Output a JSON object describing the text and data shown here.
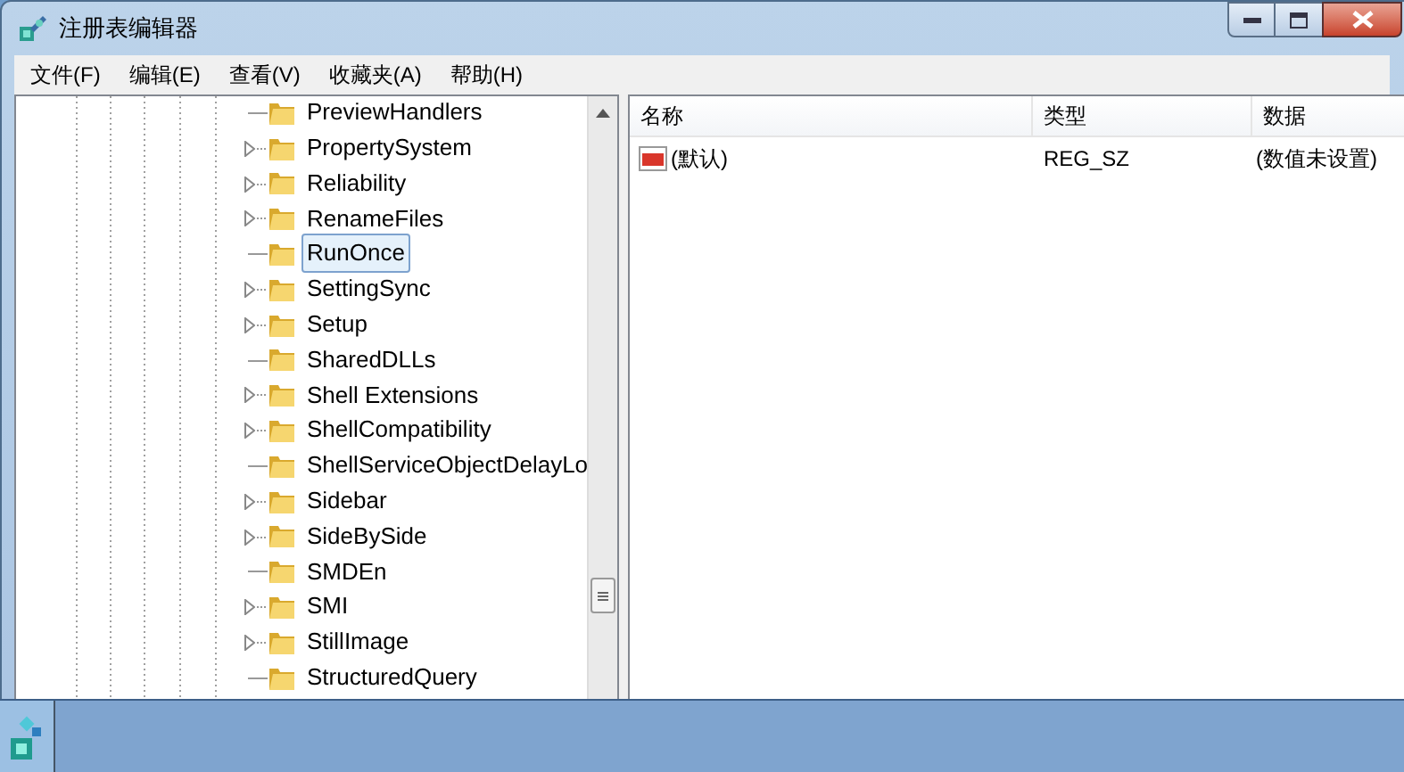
{
  "window": {
    "title": "注册表编辑器"
  },
  "menu": [
    "文件(F)",
    "编辑(E)",
    "查看(V)",
    "收藏夹(A)",
    "帮助(H)"
  ],
  "tree": [
    {
      "label": "PreviewHandlers",
      "has_children": false,
      "selected": false
    },
    {
      "label": "PropertySystem",
      "has_children": true,
      "selected": false
    },
    {
      "label": "Reliability",
      "has_children": true,
      "selected": false
    },
    {
      "label": "RenameFiles",
      "has_children": true,
      "selected": false
    },
    {
      "label": "RunOnce",
      "has_children": false,
      "selected": true
    },
    {
      "label": "SettingSync",
      "has_children": true,
      "selected": false
    },
    {
      "label": "Setup",
      "has_children": true,
      "selected": false
    },
    {
      "label": "SharedDLLs",
      "has_children": false,
      "selected": false
    },
    {
      "label": "Shell Extensions",
      "has_children": true,
      "selected": false
    },
    {
      "label": "ShellCompatibility",
      "has_children": true,
      "selected": false
    },
    {
      "label": "ShellServiceObjectDelayLo",
      "has_children": false,
      "selected": false
    },
    {
      "label": "Sidebar",
      "has_children": true,
      "selected": false
    },
    {
      "label": "SideBySide",
      "has_children": true,
      "selected": false
    },
    {
      "label": "SMDEn",
      "has_children": false,
      "selected": false
    },
    {
      "label": "SMI",
      "has_children": true,
      "selected": false
    },
    {
      "label": "StillImage",
      "has_children": true,
      "selected": false
    },
    {
      "label": "StructuredQuery",
      "has_children": false,
      "selected": false
    }
  ],
  "values": {
    "columns": [
      "名称",
      "类型",
      "数据"
    ],
    "rows": [
      {
        "name": "(默认)",
        "type": "REG_SZ",
        "data": "(数值未设置)"
      }
    ]
  }
}
